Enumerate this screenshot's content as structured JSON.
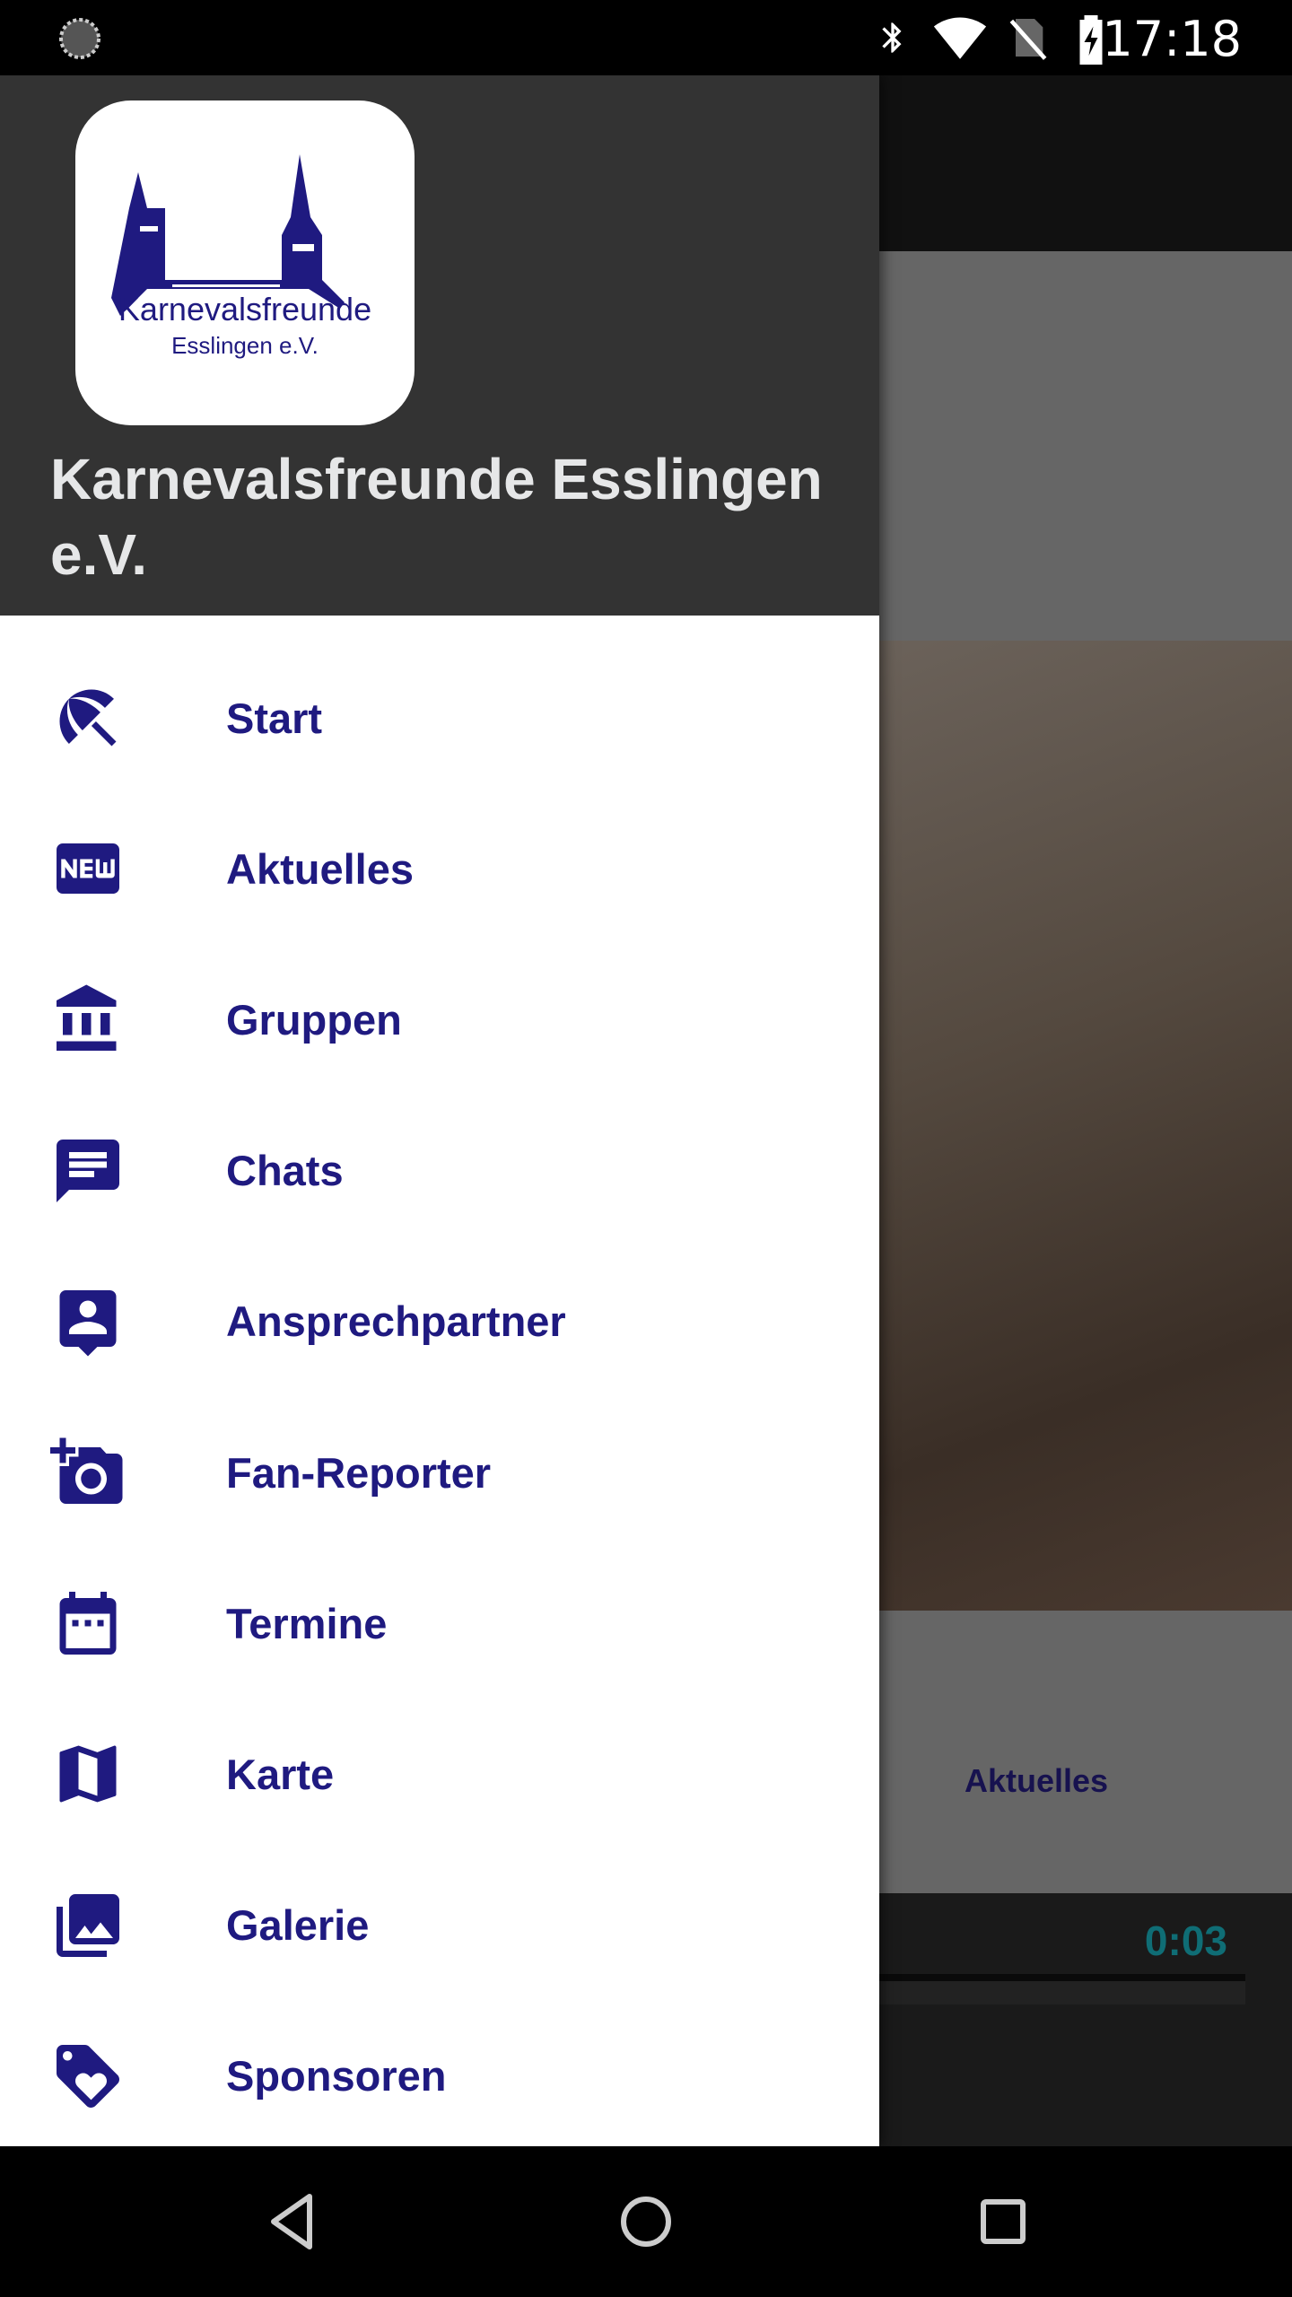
{
  "status_bar": {
    "time": "17:18",
    "icons": [
      "sync-icon",
      "bluetooth-icon",
      "wifi-icon",
      "no-sim-icon",
      "battery-charging-icon"
    ]
  },
  "drawer": {
    "logo_text": [
      "Karnevalsfreunde",
      "Esslingen e.V."
    ],
    "title": "Karnevalsfreunde Esslingen e.V.",
    "accent_color": "#1f1a80",
    "items": [
      {
        "label": "Start",
        "icon": "beach-access"
      },
      {
        "label": "Aktuelles",
        "icon": "fiber-new"
      },
      {
        "label": "Gruppen",
        "icon": "account-balance"
      },
      {
        "label": "Chats",
        "icon": "chat"
      },
      {
        "label": "Ansprechpartner",
        "icon": "person-pin"
      },
      {
        "label": "Fan-Reporter",
        "icon": "add-a-photo"
      },
      {
        "label": "Termine",
        "icon": "event"
      },
      {
        "label": "Karte",
        "icon": "map"
      },
      {
        "label": "Galerie",
        "icon": "photo-library"
      },
      {
        "label": "Sponsoren",
        "icon": "loyalty"
      }
    ]
  },
  "background": {
    "tab_label": "Aktuelles",
    "player_time": "0:03"
  },
  "nav_bar": {
    "icons": [
      "back-icon",
      "home-icon",
      "recents-icon"
    ]
  }
}
